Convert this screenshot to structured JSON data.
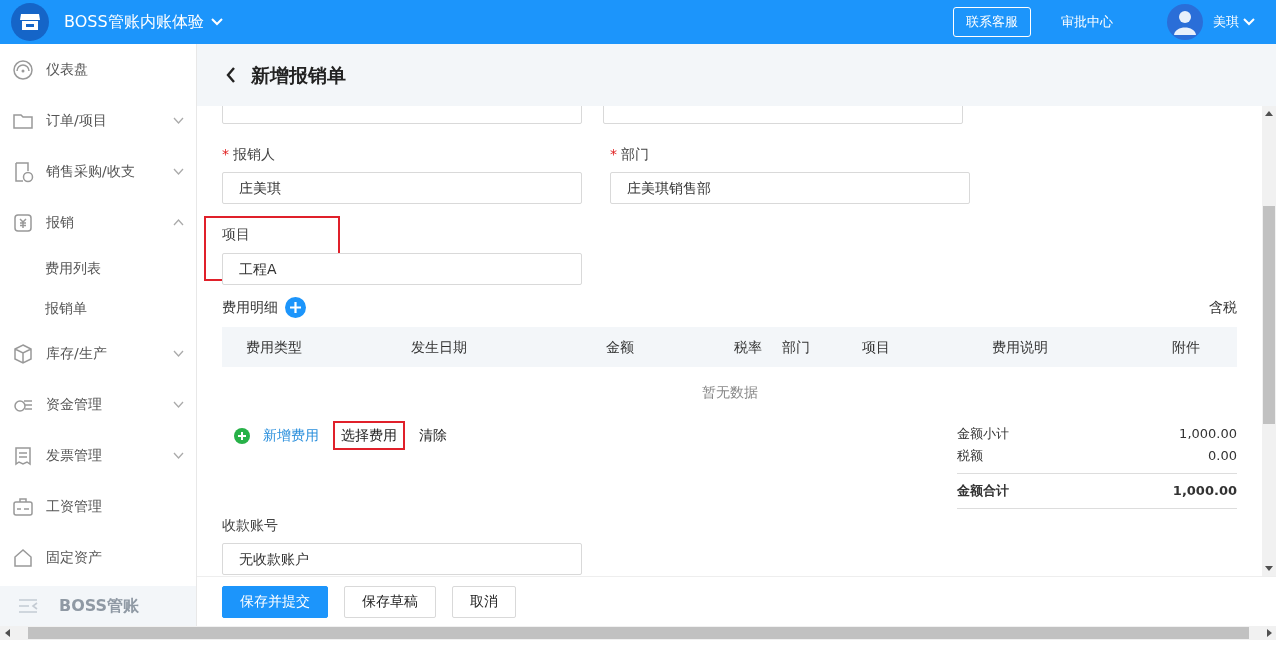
{
  "header": {
    "app_name": "BOSS管账内账体验",
    "service_button": "联系客服",
    "approval_link": "审批中心",
    "user_name": "美琪"
  },
  "sidebar": {
    "items": [
      {
        "label": "仪表盘"
      },
      {
        "label": "订单/项目",
        "expanded": false
      },
      {
        "label": "销售采购/收支",
        "expanded": false
      },
      {
        "label": "报销",
        "expanded": true,
        "children": [
          {
            "label": "费用列表",
            "selected": false
          },
          {
            "label": "报销单",
            "selected": false
          }
        ]
      },
      {
        "label": "库存/生产",
        "expanded": false
      },
      {
        "label": "资金管理",
        "expanded": false
      },
      {
        "label": "发票管理",
        "expanded": false
      },
      {
        "label": "工资管理"
      },
      {
        "label": "固定资产"
      }
    ],
    "footer": "BOSS管账"
  },
  "page": {
    "title": "新增报销单"
  },
  "form": {
    "fields": [
      {
        "label": "报销人",
        "required_mark": "*",
        "value": "庄美琪"
      },
      {
        "label": "部门",
        "required_mark": "*",
        "value": "庄美琪销售部"
      },
      {
        "label": "项目",
        "value": "工程A",
        "highlighted": true
      }
    ],
    "expenses": {
      "title": "费用明细",
      "tax_label": "含税",
      "columns": [
        "费用类型",
        "发生日期",
        "金额",
        "税率",
        "部门",
        "项目",
        "费用说明",
        "附件"
      ],
      "empty_text": "暂无数据",
      "actions": [
        {
          "label": "新增费用",
          "kind": "add",
          "highlighted": false
        },
        {
          "label": "选择费用",
          "kind": "plain",
          "highlighted": true
        },
        {
          "label": "清除",
          "kind": "plain",
          "highlighted": false
        }
      ],
      "summary": [
        {
          "label": "金额小计",
          "value": "1,000.00",
          "bold": false
        },
        {
          "label": "税额",
          "value": "0.00",
          "bold": false
        },
        {
          "label": "金额合计",
          "value": "1,000.00",
          "bold": true
        }
      ]
    },
    "account": {
      "label": "收款账号",
      "value": "无收款账户"
    }
  },
  "footer_buttons": [
    {
      "label": "保存并提交",
      "kind": "primary"
    },
    {
      "label": "保存草稿",
      "kind": "default"
    },
    {
      "label": "取消",
      "kind": "default"
    }
  ]
}
